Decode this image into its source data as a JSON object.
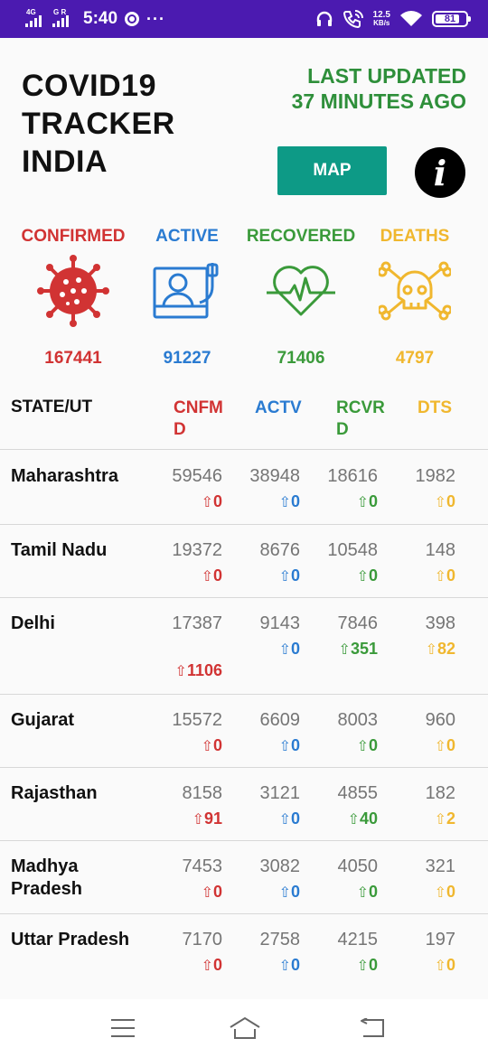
{
  "status_bar": {
    "net1": "4G",
    "net2": "G R",
    "time": "5:40",
    "more": "···",
    "speed_value": "12.5",
    "speed_unit": "KB/s",
    "battery": "81",
    "icons": [
      "signal-icon",
      "chrome-icon",
      "headphones-icon",
      "wifi-call-icon",
      "wifi-icon",
      "battery-icon"
    ]
  },
  "header": {
    "title": "COVID19\nTRACKER\nINDIA",
    "last_updated": "LAST UPDATED\n37 MINUTES AGO",
    "map_label": "MAP",
    "info_glyph": "i"
  },
  "colors": {
    "confirmed": "#d13333",
    "active": "#2a7bd1",
    "recovered": "#3a9a3a",
    "deaths": "#f0b72e",
    "status_bar": "#4b1ab0",
    "map_button": "#0d9a86",
    "updated_text": "#2e8f3a"
  },
  "summary": {
    "confirmed": {
      "label": "CONFIRMED",
      "value": "167441",
      "icon": "virus-icon"
    },
    "active": {
      "label": "ACTIVE",
      "value": "91227",
      "icon": "hospital-bed-icon"
    },
    "recovered": {
      "label": "RECOVERED",
      "value": "71406",
      "icon": "heartbeat-icon"
    },
    "deaths": {
      "label": "DEATHS",
      "value": "4797",
      "icon": "skull-icon"
    }
  },
  "table": {
    "headers": {
      "state": "STATE/UT",
      "confirmed": "CNFM\nD",
      "active": "ACTV",
      "recovered": "RCVR\nD",
      "deaths": "DTS"
    },
    "rows": [
      {
        "state": "Maharashtra",
        "confirmed": "59546",
        "confirmed_delta": "0",
        "active": "38948",
        "active_delta": "0",
        "recovered": "18616",
        "recovered_delta": "0",
        "deaths": "1982",
        "deaths_delta": "0"
      },
      {
        "state": "Tamil Nadu",
        "confirmed": "19372",
        "confirmed_delta": "0",
        "active": "8676",
        "active_delta": "0",
        "recovered": "10548",
        "recovered_delta": "0",
        "deaths": "148",
        "deaths_delta": "0"
      },
      {
        "state": "Delhi",
        "confirmed": "17387",
        "confirmed_delta": "1106",
        "active": "9143",
        "active_delta": "0",
        "recovered": "7846",
        "recovered_delta": "351",
        "deaths": "398",
        "deaths_delta": "82"
      },
      {
        "state": "Gujarat",
        "confirmed": "15572",
        "confirmed_delta": "0",
        "active": "6609",
        "active_delta": "0",
        "recovered": "8003",
        "recovered_delta": "0",
        "deaths": "960",
        "deaths_delta": "0"
      },
      {
        "state": "Rajasthan",
        "confirmed": "8158",
        "confirmed_delta": "91",
        "active": "3121",
        "active_delta": "0",
        "recovered": "4855",
        "recovered_delta": "40",
        "deaths": "182",
        "deaths_delta": "2"
      },
      {
        "state": "Madhya\nPradesh",
        "confirmed": "7453",
        "confirmed_delta": "0",
        "active": "3082",
        "active_delta": "0",
        "recovered": "4050",
        "recovered_delta": "0",
        "deaths": "321",
        "deaths_delta": "0"
      },
      {
        "state": "Uttar Pradesh",
        "confirmed": "7170",
        "confirmed_delta": "0",
        "active": "2758",
        "active_delta": "0",
        "recovered": "4215",
        "recovered_delta": "0",
        "deaths": "197",
        "deaths_delta": "0"
      }
    ]
  },
  "nav": {
    "icons": [
      "menu-icon",
      "home-icon",
      "back-icon"
    ]
  }
}
